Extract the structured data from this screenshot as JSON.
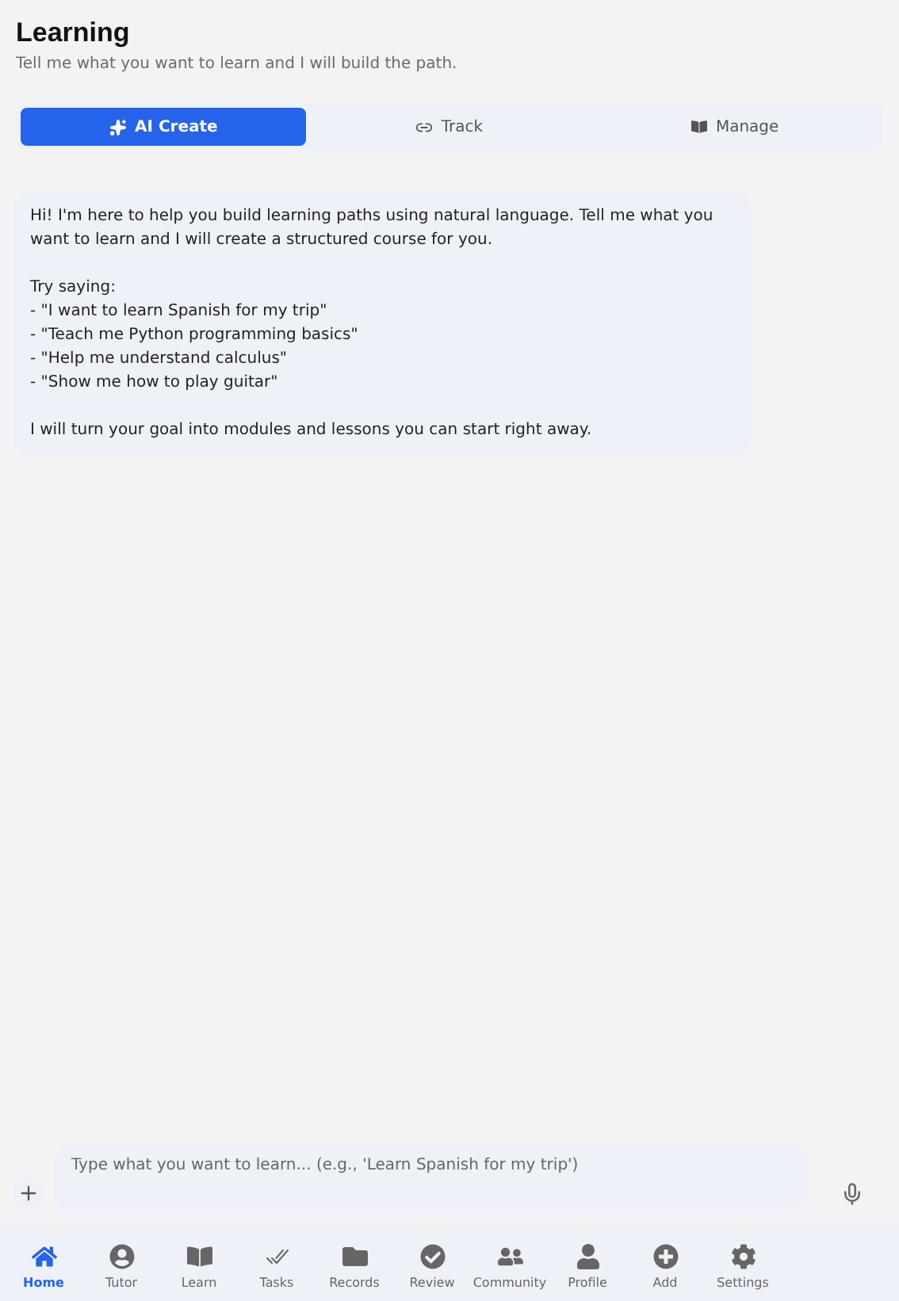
{
  "header": {
    "title": "Learning",
    "subtitle": "Tell me what you want to learn and I will build the path."
  },
  "tabs": [
    {
      "label": "AI Create",
      "selected": true
    },
    {
      "label": "Track",
      "selected": false
    },
    {
      "label": "Manage",
      "selected": false
    }
  ],
  "message": {
    "intro": "Hi! I'm here to help you build learning paths using natural language. Tell me what you want to learn and I will create a structured course for you.",
    "prompt_label": "Try saying:",
    "suggestions": [
      "- \"I want to learn Spanish for my trip\"",
      "- \"Teach me Python programming basics\"",
      "- \"Help me understand calculus\"",
      "- \"Show me how to play guitar\""
    ],
    "outro": "I will turn your goal into modules and lessons you can start right away."
  },
  "composer": {
    "placeholder": "Type what you want to learn... (e.g., 'Learn Spanish for my trip')"
  },
  "nav": [
    {
      "label": "Home",
      "selected": true
    },
    {
      "label": "Tutor",
      "selected": false
    },
    {
      "label": "Learn",
      "selected": false
    },
    {
      "label": "Tasks",
      "selected": false
    },
    {
      "label": "Records",
      "selected": false
    },
    {
      "label": "Review",
      "selected": false
    },
    {
      "label": "Community",
      "selected": false
    },
    {
      "label": "Profile",
      "selected": false
    },
    {
      "label": "Add",
      "selected": false
    },
    {
      "label": "Settings",
      "selected": false
    }
  ]
}
